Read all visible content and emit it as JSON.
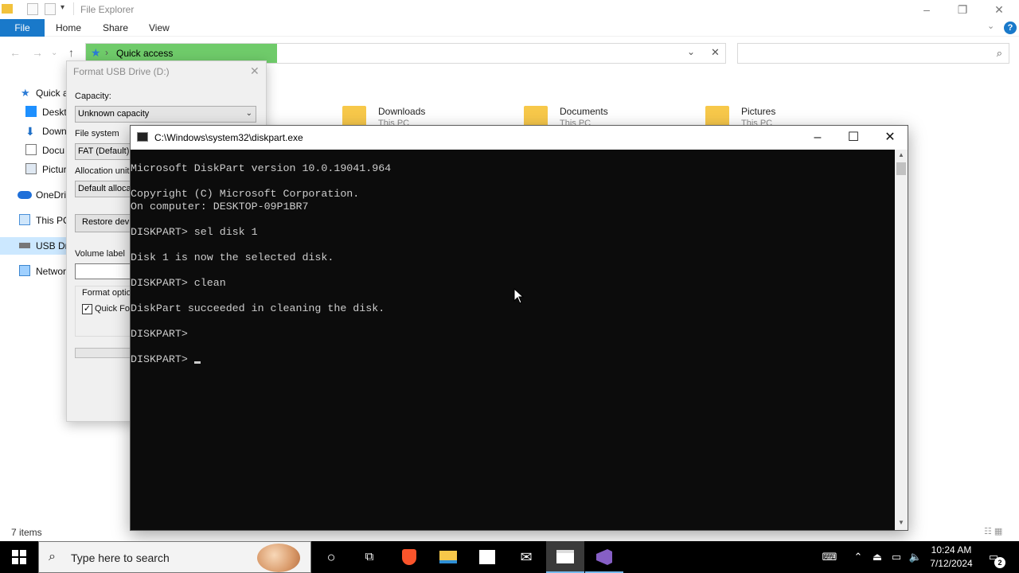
{
  "explorer": {
    "title": "File Explorer",
    "tabs": [
      "File",
      "Home",
      "Share",
      "View"
    ],
    "help": "?",
    "address": "Quick access",
    "nav": [
      {
        "label": "Quick a",
        "icon": "star-icon"
      },
      {
        "label": "Deskt",
        "icon": "desktop-icon"
      },
      {
        "label": "Down",
        "icon": "download-icon"
      },
      {
        "label": "Docu",
        "icon": "document-icon"
      },
      {
        "label": "Pictur",
        "icon": "picture-icon"
      },
      {
        "label": "OneDri",
        "icon": "onedrive-icon"
      },
      {
        "label": "This PC",
        "icon": "computer-icon"
      },
      {
        "label": "USB Dri",
        "icon": "usb-drive-icon"
      },
      {
        "label": "Networ",
        "icon": "network-icon"
      }
    ],
    "folders": [
      {
        "name": "Downloads",
        "sub": "This PC"
      },
      {
        "name": "Documents",
        "sub": "This PC"
      },
      {
        "name": "Pictures",
        "sub": "This PC"
      }
    ],
    "status": "7 items"
  },
  "format_dialog": {
    "title": "Format USB Drive (D:)",
    "capacity_label": "Capacity:",
    "capacity_value": "Unknown capacity",
    "filesystem_label": "File system",
    "filesystem_value": "FAT (Default)",
    "allocation_label": "Allocation unit",
    "allocation_value": "Default alloca",
    "restore_label": "Restore devi",
    "volume_label": "Volume label",
    "format_options_label": "Format optio",
    "quick_format_label": "Quick For",
    "quick_format_checked": true
  },
  "console": {
    "title": "C:\\Windows\\system32\\diskpart.exe",
    "lines": [
      "Microsoft DiskPart version 10.0.19041.964",
      "",
      "Copyright (C) Microsoft Corporation.",
      "On computer: DESKTOP-09P1BR7",
      "",
      "DISKPART> sel disk 1",
      "",
      "Disk 1 is now the selected disk.",
      "",
      "DISKPART> clean",
      "",
      "DiskPart succeeded in cleaning the disk.",
      "",
      "DISKPART>",
      "",
      "DISKPART> "
    ]
  },
  "taskbar": {
    "search_placeholder": "Type here to search",
    "time": "10:24 AM",
    "date": "7/12/2024",
    "notification_count": "2",
    "apps": [
      "cortana-icon",
      "task-view-icon",
      "brave-browser-icon",
      "file-explorer-icon",
      "microsoft-store-icon",
      "mail-icon",
      "terminal-icon",
      "visual-studio-icon"
    ]
  }
}
